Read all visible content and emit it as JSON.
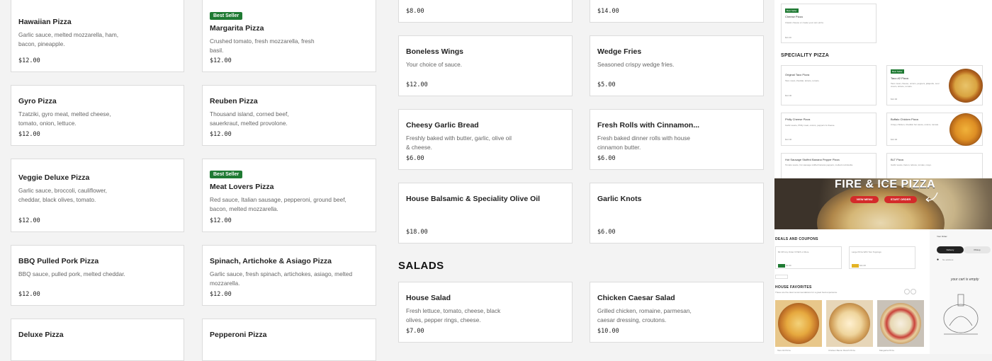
{
  "col1": [
    {
      "name": "Hawaiian Pizza",
      "desc": "Garlic sauce, melted mozzarella, ham, bacon, pineapple.",
      "price": "$12.00"
    },
    {
      "name": "Gyro Pizza",
      "desc": "Tzatziki, gyro meat, melted cheese, tomato, onion, lettuce.",
      "price": "$12.00"
    },
    {
      "name": "Veggie Deluxe Pizza",
      "desc": "Garlic sauce, broccoli, cauliflower, cheddar, black olives, tomato.",
      "price": "$12.00"
    },
    {
      "name": "BBQ Pulled Pork Pizza",
      "desc": "BBQ sauce, pulled pork, melted cheddar.",
      "price": "$12.00"
    },
    {
      "name": "Deluxe Pizza"
    }
  ],
  "col2": [
    {
      "badge": "Best Seller",
      "name": "Margarita Pizza",
      "desc": "Crushed tomato, fresh mozzarella, fresh basil.",
      "price": "$12.00"
    },
    {
      "name": "Reuben Pizza",
      "desc": "Thousand island, corned beef, sauerkraut, melted provolone.",
      "price": "$12.00"
    },
    {
      "badge": "Best Seller",
      "name": "Meat Lovers Pizza",
      "desc": "Red sauce, Italian sausage, pepperoni, ground beef, bacon, melted mozzarella.",
      "price": "$12.00"
    },
    {
      "name": "Spinach, Artichoke & Asiago Pizza",
      "desc": "Garlic sauce, fresh spinach, artichokes, asiago, melted mozzarella.",
      "price": "$12.00"
    },
    {
      "name": "Pepperoni Pizza"
    }
  ],
  "col3": [
    {
      "price": "$8.00"
    },
    {
      "name": "Boneless Wings",
      "desc": "Your choice of sauce.",
      "price": "$12.00"
    },
    {
      "name": "Cheesy Garlic Bread",
      "desc": "Freshly baked with butter, garlic, olive oil & cheese.",
      "price": "$6.00"
    },
    {
      "name": "House Balsamic & Speciality Olive Oil",
      "price": "$18.00"
    },
    {
      "name": "House Salad",
      "desc": "Fresh lettuce, tomato, cheese, black olives, pepper rings, cheese.",
      "price": "$7.00"
    }
  ],
  "col4": [
    {
      "price": "$14.00"
    },
    {
      "name": "Wedge Fries",
      "desc": "Seasoned crispy wedge fries.",
      "price": "$5.00"
    },
    {
      "name": "Fresh Rolls with Cinnamon...",
      "desc": "Fresh baked dinner rolls with house cinnamon butter.",
      "price": "$6.00"
    },
    {
      "name": "Garlic Knots",
      "price": "$6.00"
    },
    {
      "name": "Chicken Caesar Salad",
      "desc": "Grilled chicken, romaine, parmesan, caesar dressing, croutons.",
      "price": "$10.00"
    }
  ],
  "sections": {
    "salads": "SALADS"
  },
  "preview": {
    "cheese": {
      "badge": "Best Seller",
      "name": "Cheese Pizza",
      "desc": "Classic cheese or create your own pizza.",
      "price": "$11.00"
    },
    "speciality_title": "SPECIALITY PIZZA",
    "items": [
      {
        "name": "Original Taco Pizza",
        "desc": "Taco meat, cheddar, lettuce, tomato.",
        "price": "$12.00"
      },
      {
        "badge": "Best Seller",
        "name": "Taco #2 Pizza",
        "desc": "Taco meat, cheese, onions, peppers, jalapeño, sour cream, lettuce, tomato.",
        "price": "$12.00"
      },
      {
        "name": "Philly Cheese Pizza",
        "desc": "Garlic sauce, Philly meat, onions, peppers & cheese.",
        "price": "$12.00"
      },
      {
        "name": "Buffalo Chicken Pizza",
        "desc": "Crispy chicken, cheddar hot sauce, onions, tomato.",
        "price": "$12.00"
      },
      {
        "name": "Hot Sausage Stuffed Banana Pepper Pizza",
        "desc": "Tomato sauce, hot sausage stuffed banana peppers, melted mozzarella."
      },
      {
        "name": "BLT Pizza",
        "desc": "Garlic sauce, bacon, lettuce, tomato, mayo."
      }
    ],
    "hero": {
      "title": "FIRE & ICE PIZZA",
      "view_menu": "VIEW MENU",
      "start_order": "START ORDER"
    },
    "deals_title": "DEALS AND COUPONS",
    "deals": [
      {
        "text": "$3 Off Any Order Of $15 or More",
        "price": "$1.00"
      },
      {
        "text": "Large Pizza With Two Toppings",
        "price": "$11.00"
      }
    ],
    "house_fav_title": "HOUSE FAVORITES",
    "house_fav_sub": "These are the clear recommendations for a great food experience.",
    "favorites": [
      "Taco #2 Pizza",
      "Chicken Bacon Ranch Pizza",
      "Margarita Pizza"
    ],
    "order": {
      "title": "Your Order",
      "delivery": "Delivery",
      "pickup": "Pickup",
      "address": "No address",
      "empty": "your cart is empty"
    }
  },
  "colors": {
    "badge": "#1f7a33",
    "hero_button": "#d42a2a"
  }
}
